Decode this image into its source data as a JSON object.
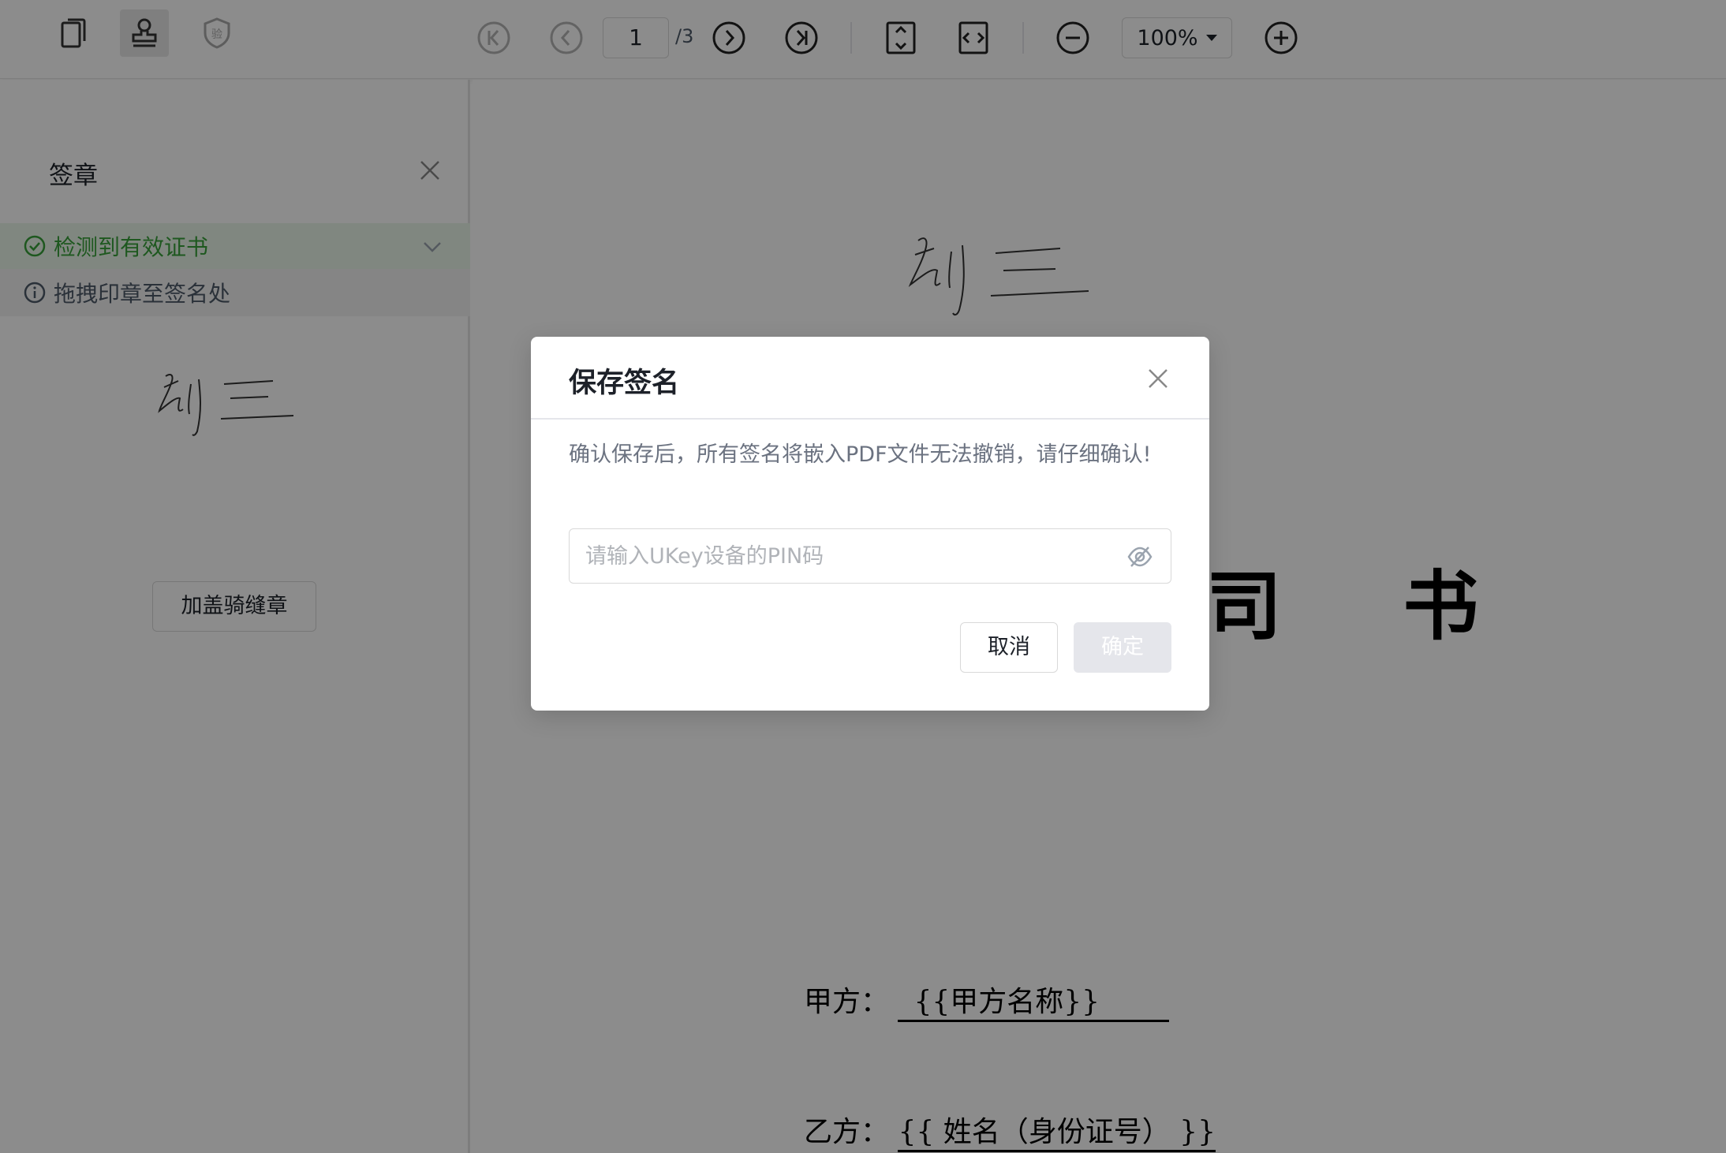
{
  "toolbar": {
    "left_icons": [
      "copy-pages-icon",
      "stamp-icon",
      "verify-shield-icon"
    ],
    "verify_icon_glyph": "验",
    "nav_icons": [
      "first-page-icon",
      "prev-page-icon",
      "next-page-icon",
      "last-page-icon"
    ],
    "current_page": "1",
    "total_pages": "/3",
    "fit_icons": [
      "fit-height-icon",
      "fit-width-icon"
    ],
    "zoom": "100%",
    "zoom_icons": [
      "zoom-out-icon",
      "zoom-in-icon"
    ]
  },
  "panel": {
    "title": "签章",
    "cert_status": "检测到有效证书",
    "hint": "拖拽印章至签名处",
    "seam_stamp_button": "加盖骑缝章"
  },
  "document": {
    "title_partial": "司 书",
    "party_a_label": "甲方：",
    "party_a_field": "{{甲方名称}}",
    "party_b_label": "乙方：",
    "party_b_field": "{{  姓名（身份证号）  }}"
  },
  "dialog": {
    "title": "保存签名",
    "message": "确认保存后，所有签名将嵌入PDF文件无法撤销，请仔细确认!",
    "pin_placeholder": "请输入UKey设备的PIN码",
    "pin_value": "",
    "cancel_label": "取消",
    "confirm_label": "确定"
  },
  "colors": {
    "success": "#37a13a",
    "success_bg": "#eaf6ea",
    "disabled_button": "#e5e6eb",
    "mask": "rgba(0,0,0,0.45)"
  }
}
